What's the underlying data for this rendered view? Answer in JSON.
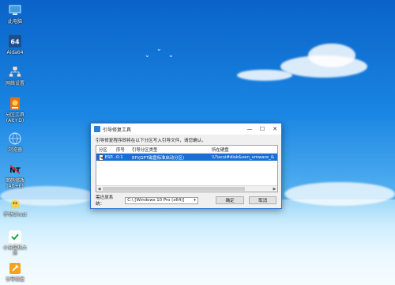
{
  "desktop": {
    "icons": [
      {
        "label": "此电脑",
        "icon": "computer-icon"
      },
      {
        "label": "Aida64",
        "icon": "aida64-icon"
      },
      {
        "label": "网络设置",
        "icon": "network-icon"
      },
      {
        "label": "分区工具\n(Alt+D)",
        "icon": "partition-tool-icon"
      },
      {
        "label": "浏览器",
        "icon": "browser-icon"
      },
      {
        "label": "密码修改\n(Alt+E)",
        "icon": "password-tool-icon"
      },
      {
        "label": "手动Ghost",
        "icon": "ghost-icon"
      },
      {
        "label": "小白装机大\n师",
        "icon": "installer-icon"
      },
      {
        "label": "引导修复",
        "icon": "boot-repair-icon"
      }
    ]
  },
  "window": {
    "title": "引导修复工具",
    "hint": "引导修复程序即将在以下分区写入引导文件，请您确认。",
    "columns": [
      "分区",
      "序号",
      "引导分区类型",
      "所在硬盘"
    ],
    "rows": [
      {
        "partition": "ESP...",
        "index": "0:1",
        "type": "EFI(GPT磁盘标准启动分区)",
        "disk": "\\\\?\\scsi#disk&ven_vmware_&"
      }
    ],
    "target_label": "需还原系统：",
    "target_value": "C:\\ [Windows 10 Pro (x64)]",
    "ok_label": "确定",
    "cancel_label": "取消"
  }
}
